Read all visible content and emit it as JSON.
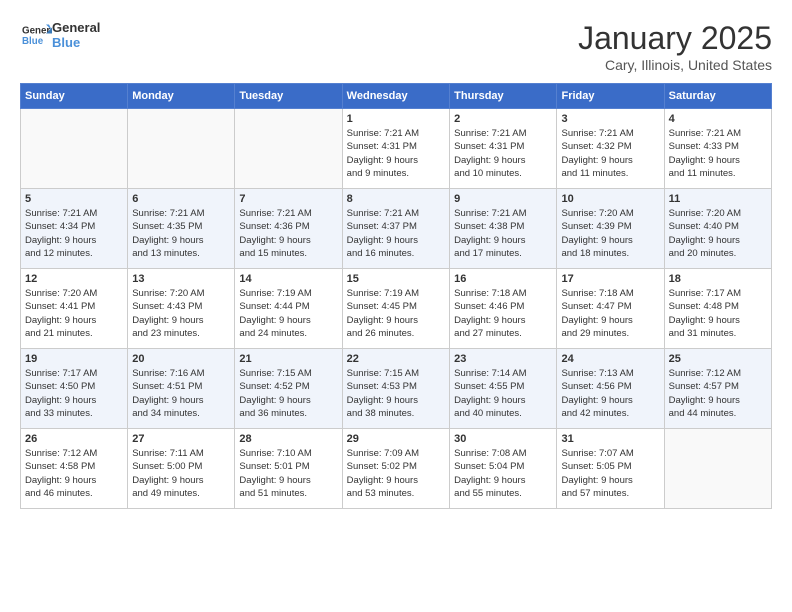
{
  "header": {
    "logo_text_general": "General",
    "logo_text_blue": "Blue",
    "month_title": "January 2025",
    "location": "Cary, Illinois, United States"
  },
  "weekdays": [
    "Sunday",
    "Monday",
    "Tuesday",
    "Wednesday",
    "Thursday",
    "Friday",
    "Saturday"
  ],
  "weeks": [
    [
      {
        "day": "",
        "info": ""
      },
      {
        "day": "",
        "info": ""
      },
      {
        "day": "",
        "info": ""
      },
      {
        "day": "1",
        "info": "Sunrise: 7:21 AM\nSunset: 4:31 PM\nDaylight: 9 hours\nand 9 minutes."
      },
      {
        "day": "2",
        "info": "Sunrise: 7:21 AM\nSunset: 4:31 PM\nDaylight: 9 hours\nand 10 minutes."
      },
      {
        "day": "3",
        "info": "Sunrise: 7:21 AM\nSunset: 4:32 PM\nDaylight: 9 hours\nand 11 minutes."
      },
      {
        "day": "4",
        "info": "Sunrise: 7:21 AM\nSunset: 4:33 PM\nDaylight: 9 hours\nand 11 minutes."
      }
    ],
    [
      {
        "day": "5",
        "info": "Sunrise: 7:21 AM\nSunset: 4:34 PM\nDaylight: 9 hours\nand 12 minutes."
      },
      {
        "day": "6",
        "info": "Sunrise: 7:21 AM\nSunset: 4:35 PM\nDaylight: 9 hours\nand 13 minutes."
      },
      {
        "day": "7",
        "info": "Sunrise: 7:21 AM\nSunset: 4:36 PM\nDaylight: 9 hours\nand 15 minutes."
      },
      {
        "day": "8",
        "info": "Sunrise: 7:21 AM\nSunset: 4:37 PM\nDaylight: 9 hours\nand 16 minutes."
      },
      {
        "day": "9",
        "info": "Sunrise: 7:21 AM\nSunset: 4:38 PM\nDaylight: 9 hours\nand 17 minutes."
      },
      {
        "day": "10",
        "info": "Sunrise: 7:20 AM\nSunset: 4:39 PM\nDaylight: 9 hours\nand 18 minutes."
      },
      {
        "day": "11",
        "info": "Sunrise: 7:20 AM\nSunset: 4:40 PM\nDaylight: 9 hours\nand 20 minutes."
      }
    ],
    [
      {
        "day": "12",
        "info": "Sunrise: 7:20 AM\nSunset: 4:41 PM\nDaylight: 9 hours\nand 21 minutes."
      },
      {
        "day": "13",
        "info": "Sunrise: 7:20 AM\nSunset: 4:43 PM\nDaylight: 9 hours\nand 23 minutes."
      },
      {
        "day": "14",
        "info": "Sunrise: 7:19 AM\nSunset: 4:44 PM\nDaylight: 9 hours\nand 24 minutes."
      },
      {
        "day": "15",
        "info": "Sunrise: 7:19 AM\nSunset: 4:45 PM\nDaylight: 9 hours\nand 26 minutes."
      },
      {
        "day": "16",
        "info": "Sunrise: 7:18 AM\nSunset: 4:46 PM\nDaylight: 9 hours\nand 27 minutes."
      },
      {
        "day": "17",
        "info": "Sunrise: 7:18 AM\nSunset: 4:47 PM\nDaylight: 9 hours\nand 29 minutes."
      },
      {
        "day": "18",
        "info": "Sunrise: 7:17 AM\nSunset: 4:48 PM\nDaylight: 9 hours\nand 31 minutes."
      }
    ],
    [
      {
        "day": "19",
        "info": "Sunrise: 7:17 AM\nSunset: 4:50 PM\nDaylight: 9 hours\nand 33 minutes."
      },
      {
        "day": "20",
        "info": "Sunrise: 7:16 AM\nSunset: 4:51 PM\nDaylight: 9 hours\nand 34 minutes."
      },
      {
        "day": "21",
        "info": "Sunrise: 7:15 AM\nSunset: 4:52 PM\nDaylight: 9 hours\nand 36 minutes."
      },
      {
        "day": "22",
        "info": "Sunrise: 7:15 AM\nSunset: 4:53 PM\nDaylight: 9 hours\nand 38 minutes."
      },
      {
        "day": "23",
        "info": "Sunrise: 7:14 AM\nSunset: 4:55 PM\nDaylight: 9 hours\nand 40 minutes."
      },
      {
        "day": "24",
        "info": "Sunrise: 7:13 AM\nSunset: 4:56 PM\nDaylight: 9 hours\nand 42 minutes."
      },
      {
        "day": "25",
        "info": "Sunrise: 7:12 AM\nSunset: 4:57 PM\nDaylight: 9 hours\nand 44 minutes."
      }
    ],
    [
      {
        "day": "26",
        "info": "Sunrise: 7:12 AM\nSunset: 4:58 PM\nDaylight: 9 hours\nand 46 minutes."
      },
      {
        "day": "27",
        "info": "Sunrise: 7:11 AM\nSunset: 5:00 PM\nDaylight: 9 hours\nand 49 minutes."
      },
      {
        "day": "28",
        "info": "Sunrise: 7:10 AM\nSunset: 5:01 PM\nDaylight: 9 hours\nand 51 minutes."
      },
      {
        "day": "29",
        "info": "Sunrise: 7:09 AM\nSunset: 5:02 PM\nDaylight: 9 hours\nand 53 minutes."
      },
      {
        "day": "30",
        "info": "Sunrise: 7:08 AM\nSunset: 5:04 PM\nDaylight: 9 hours\nand 55 minutes."
      },
      {
        "day": "31",
        "info": "Sunrise: 7:07 AM\nSunset: 5:05 PM\nDaylight: 9 hours\nand 57 minutes."
      },
      {
        "day": "",
        "info": ""
      }
    ]
  ]
}
